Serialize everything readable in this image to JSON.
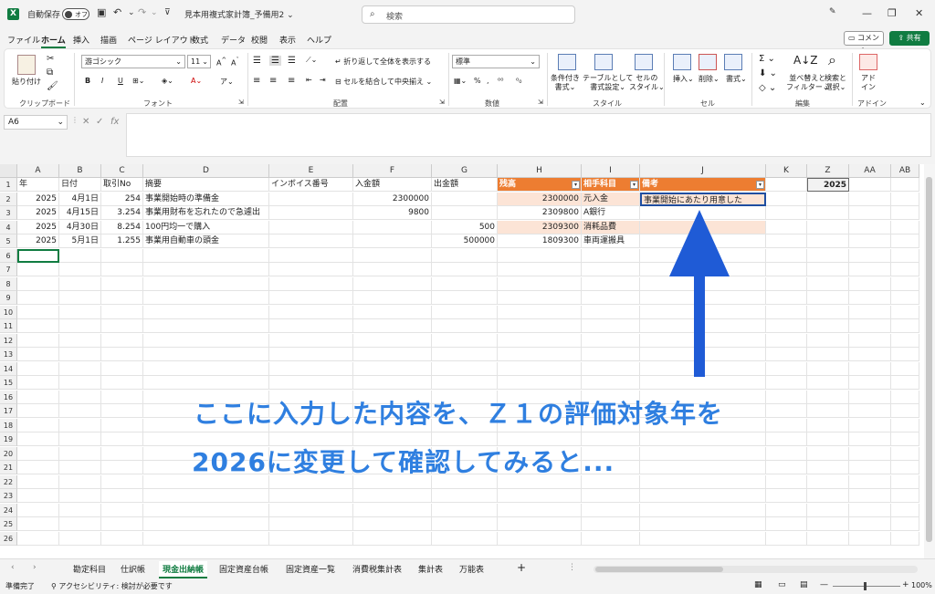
{
  "titlebar": {
    "autosave_label": "自動保存",
    "autosave_state": "オフ",
    "file_title": "見本用複式家計簿_予備用2",
    "search_placeholder": "検索"
  },
  "menu": {
    "items": [
      "ファイル",
      "ホーム",
      "挿入",
      "描画",
      "ページ レイアウト",
      "数式",
      "データ",
      "校閲",
      "表示",
      "ヘルプ"
    ],
    "active": "ホーム",
    "comment_label": "コメント",
    "share_label": "共有"
  },
  "ribbon": {
    "clipboard": {
      "label": "クリップボード",
      "paste": "貼り付け"
    },
    "font": {
      "label": "フォント",
      "name": "游ゴシック",
      "size": "11",
      "bold": "B",
      "italic": "I",
      "underline": "U"
    },
    "alignment": {
      "label": "配置",
      "wrap": "折り返して全体を表示する",
      "merge": "セルを結合して中央揃え"
    },
    "number": {
      "label": "数値",
      "format": "標準"
    },
    "styles": {
      "label": "スタイル",
      "conditional_1": "条件付き",
      "conditional_2": "書式",
      "table_1": "テーブルとして",
      "table_2": "書式設定",
      "cell_1": "セルの",
      "cell_2": "スタイル"
    },
    "cells": {
      "label": "セル",
      "insert": "挿入",
      "delete": "削除",
      "format": "書式"
    },
    "editing": {
      "label": "編集",
      "sort_1": "並べ替えと",
      "sort_2": "フィルター",
      "find_1": "検索と",
      "find_2": "選択"
    },
    "addins": {
      "label": "アドイン",
      "addin_1": "アド",
      "addin_2": "イン"
    }
  },
  "formula_bar": {
    "cell_ref": "A6",
    "fx": "fx",
    "content": ""
  },
  "columns": [
    "A",
    "B",
    "C",
    "D",
    "E",
    "F",
    "G",
    "H",
    "I",
    "J",
    "K",
    "Z",
    "AA",
    "AB"
  ],
  "rows": [
    "1",
    "2",
    "3",
    "4",
    "5",
    "6",
    "7",
    "8",
    "9",
    "10",
    "11",
    "12",
    "13",
    "14",
    "15",
    "16",
    "17",
    "18",
    "19",
    "20",
    "21",
    "22",
    "23",
    "24",
    "25",
    "26"
  ],
  "header_row": {
    "a": "年",
    "b": "日付",
    "c": "取引No",
    "d": "摘要",
    "e": "インボイス番号",
    "f": "入金額",
    "g": "出金額",
    "h": "残高",
    "i": "相手科目",
    "j": "備考",
    "z": "2025"
  },
  "data_rows": [
    {
      "a": "2025",
      "b": "4月1日",
      "c": "254",
      "d": "事業開始時の準備金",
      "e": "",
      "f": "2300000",
      "g": "",
      "h": "2300000",
      "i": "元入金",
      "j": "事業開始にあたり用意した"
    },
    {
      "a": "2025",
      "b": "4月15日",
      "c": "3.254",
      "d": "事業用財布を忘れたので急遽出",
      "e": "",
      "f": "9800",
      "g": "",
      "h": "2309800",
      "i": "A銀行",
      "j": ""
    },
    {
      "a": "2025",
      "b": "4月30日",
      "c": "8.254",
      "d": "100円均一で購入",
      "e": "",
      "f": "",
      "g": "500",
      "h": "2309300",
      "i": "消耗品費",
      "j": ""
    },
    {
      "a": "2025",
      "b": "5月1日",
      "c": "1.255",
      "d": "事業用自動車の頭金",
      "e": "",
      "f": "",
      "g": "500000",
      "h": "1809300",
      "i": "車両運搬具",
      "j": ""
    }
  ],
  "annotation": {
    "line1": "ここに入力した内容を、Ｚ１の評価対象年を",
    "line2": "2026に変更して確認してみると...",
    "arrow_color": "#1f5bd6",
    "text_color": "#2f7fe0"
  },
  "sheet_tabs": [
    "勘定科目",
    "仕訳帳",
    "現金出納帳",
    "固定資産台帳",
    "固定資産一覧",
    "消費税集計表",
    "集計表",
    "万能表"
  ],
  "active_sheet": "現金出納帳",
  "status": {
    "ready": "準備完了",
    "accessibility": "アクセシビリティ: 検討が必要です",
    "zoom": "100%"
  },
  "colors": {
    "excel_green": "#107c41",
    "header_orange": "#ed7d31",
    "peach": "#fce4d6"
  }
}
